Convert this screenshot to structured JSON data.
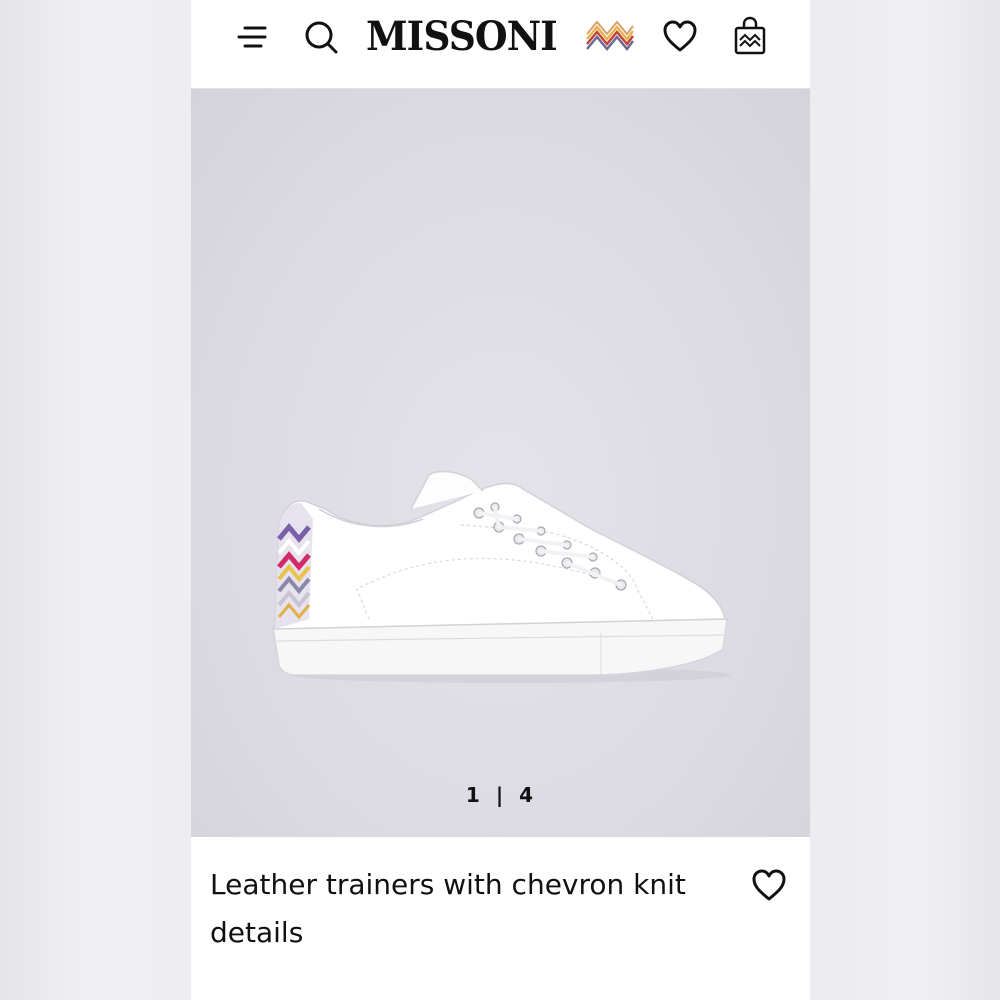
{
  "header": {
    "brand": "MISSONI",
    "icons": [
      "menu-icon",
      "search-icon",
      "chevron-logo-icon",
      "heart-icon",
      "shopping-bag-icon"
    ]
  },
  "gallery": {
    "current": "1",
    "separator": "|",
    "total": "4"
  },
  "product": {
    "title": "Leather trainers with chevron knit details"
  },
  "colors": {
    "gallery_bg": "#dcdbe3",
    "text": "#111111",
    "page_bg": "#ffffff"
  }
}
